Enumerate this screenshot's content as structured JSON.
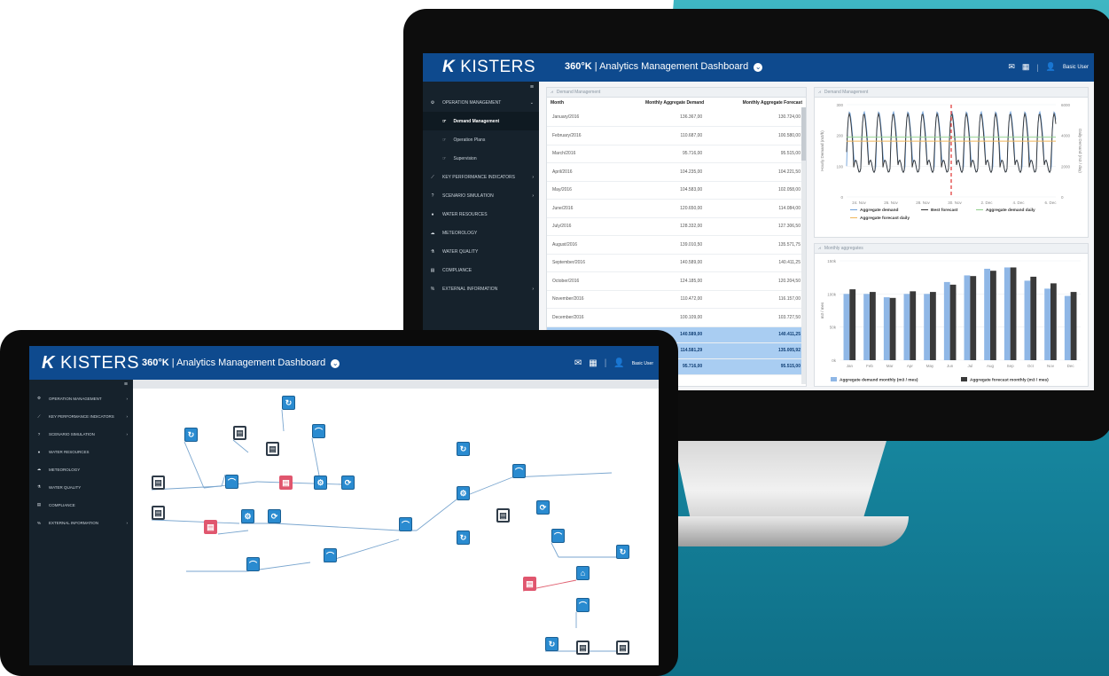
{
  "monitor": {
    "logo_text": "KISTERS",
    "app_title_bold": "360°K",
    "app_title_rest": " | Analytics Management Dashboard",
    "user_label": "Basic User",
    "sidebar": {
      "items": [
        {
          "label": "OPERATION MANAGEMENT",
          "icon": "gear-icon",
          "chevron": "⌄"
        },
        {
          "label": "KEY PERFORMANCE INDICATORS",
          "icon": "trend-icon",
          "chevron": "›"
        },
        {
          "label": "SCENARIO SIMULATION",
          "icon": "question-icon",
          "chevron": "›"
        },
        {
          "label": "WATER RESOURCES",
          "icon": "drop-icon",
          "chevron": ""
        },
        {
          "label": "METEOROLOGY",
          "icon": "cloud-icon",
          "chevron": ""
        },
        {
          "label": "WATER QUALITY",
          "icon": "flask-icon",
          "chevron": ""
        },
        {
          "label": "COMPLIANCE",
          "icon": "document-icon",
          "chevron": ""
        },
        {
          "label": "EXTERNAL INFORMATION",
          "icon": "link-icon",
          "chevron": "›"
        }
      ],
      "subitems": [
        "Demand Management",
        "Operation Plans",
        "Supervision"
      ]
    },
    "table_panel": {
      "title": "Demand Management",
      "headers": [
        "Month",
        "Monthly Aggregate Demand",
        "Monthly Aggregate Forecast"
      ],
      "rows": [
        [
          "January/2016",
          "136.367,00",
          "130.724,00"
        ],
        [
          "February/2016",
          "110.687,00",
          "100.580,00"
        ],
        [
          "March/2016",
          "95.716,00",
          "95.515,00"
        ],
        [
          "April/2016",
          "104.235,00",
          "104.221,50"
        ],
        [
          "May/2016",
          "104.583,00",
          "102.058,00"
        ],
        [
          "June/2016",
          "120.650,00",
          "114.084,00"
        ],
        [
          "July/2016",
          "128.332,00",
          "127.306,50"
        ],
        [
          "August/2016",
          "139.010,50",
          "135.571,75"
        ],
        [
          "September/2016",
          "140.589,00",
          "140.411,25"
        ],
        [
          "October/2016",
          "124.185,00",
          "120.204,50"
        ],
        [
          "November/2016",
          "110.472,00",
          "116.157,00"
        ],
        [
          "December/2016",
          "100.109,00",
          "103.727,50"
        ]
      ],
      "summary": [
        [
          "",
          "140.589,00",
          "140.411,25"
        ],
        [
          "",
          "114.581,29",
          "135.005,92"
        ],
        [
          "",
          "95.716,00",
          "95.515,00"
        ]
      ]
    },
    "line_panel": {
      "title": "Demand Management",
      "y_left_label": "Hourly Demand (m3/h)",
      "y_right_label": "Daily Demand (m3 / day)",
      "y_left_ticks": [
        "300",
        "200",
        "100",
        "0"
      ],
      "y_right_ticks": [
        "6000",
        "4000",
        "2000",
        "0"
      ],
      "x_ticks": [
        "24. Nov",
        "26. Nov",
        "28. Nov",
        "30. Nov",
        "2. Dec",
        "4. Dec",
        "6. Dec"
      ],
      "legend": [
        "Aggregate demand",
        "Best forecast",
        "Aggregate demand daily",
        "Aggregate forecast daily"
      ],
      "colors": {
        "demand": "#6fa0d8",
        "forecast": "#333333",
        "daily": "#8fd08a",
        "forecast_daily": "#f0b65a",
        "now": "#e0312f"
      }
    },
    "bar_panel": {
      "title": "Monthly aggregates",
      "y_label": "m3 / mes",
      "colors": {
        "demand": "#8fb7e6",
        "forecast": "#3a3a3a"
      }
    }
  },
  "tablet": {
    "logo_text": "KISTERS",
    "app_title_bold": "360°K",
    "app_title_rest": " | Analytics Management Dashboard",
    "user_label": "Basic User",
    "sidebar": {
      "items": [
        {
          "label": "OPERATION MANAGEMENT",
          "icon": "gear-icon",
          "chevron": "›"
        },
        {
          "label": "KEY PERFORMANCE INDICATORS",
          "icon": "trend-icon",
          "chevron": "›"
        },
        {
          "label": "SCENARIO SIMULATION",
          "icon": "question-icon",
          "chevron": "›"
        },
        {
          "label": "WATER RESOURCES",
          "icon": "drop-icon",
          "chevron": ""
        },
        {
          "label": "METEOROLOGY",
          "icon": "cloud-icon",
          "chevron": ""
        },
        {
          "label": "WATER QUALITY",
          "icon": "flask-icon",
          "chevron": ""
        },
        {
          "label": "COMPLIANCE",
          "icon": "document-icon",
          "chevron": ""
        },
        {
          "label": "EXTERNAL INFORMATION",
          "icon": "link-icon",
          "chevron": "›"
        }
      ]
    }
  },
  "chart_data": [
    {
      "type": "line",
      "title": "Demand Management",
      "x_ticks": [
        "24. Nov",
        "26. Nov",
        "28. Nov",
        "30. Nov",
        "2. Dec",
        "4. Dec",
        "6. Dec"
      ],
      "ylim_left": [
        0,
        300
      ],
      "ylim_right": [
        0,
        6000
      ],
      "series": [
        {
          "name": "Aggregate demand",
          "pattern": "daily-cycle",
          "min": 90,
          "max": 290
        },
        {
          "name": "Best forecast",
          "pattern": "daily-cycle",
          "min": 95,
          "max": 280
        },
        {
          "name": "Aggregate demand daily",
          "values_approx": 3900
        },
        {
          "name": "Aggregate forecast daily",
          "values_approx": 3800
        }
      ]
    },
    {
      "type": "bar",
      "title": "Monthly aggregates",
      "categories": [
        "Jan",
        "Feb",
        "Mar",
        "Apr",
        "May",
        "Jun",
        "Jul",
        "Aug",
        "Sep",
        "Oct",
        "Nov",
        "Dec"
      ],
      "ylim": [
        0,
        150000
      ],
      "y_ticks": [
        "150k",
        "100k",
        "50k",
        "0k"
      ],
      "series": [
        {
          "name": "Aggregate demand monthly (m3 / mes)",
          "values": [
            100000,
            100000,
            95000,
            100000,
            100000,
            118000,
            128000,
            138000,
            140000,
            120000,
            108000,
            97000
          ]
        },
        {
          "name": "Aggregate forecast monthly (m3 / mes)",
          "values": [
            107000,
            103000,
            94000,
            104000,
            103000,
            114000,
            127000,
            135000,
            140000,
            126000,
            116000,
            103000
          ]
        }
      ]
    }
  ]
}
